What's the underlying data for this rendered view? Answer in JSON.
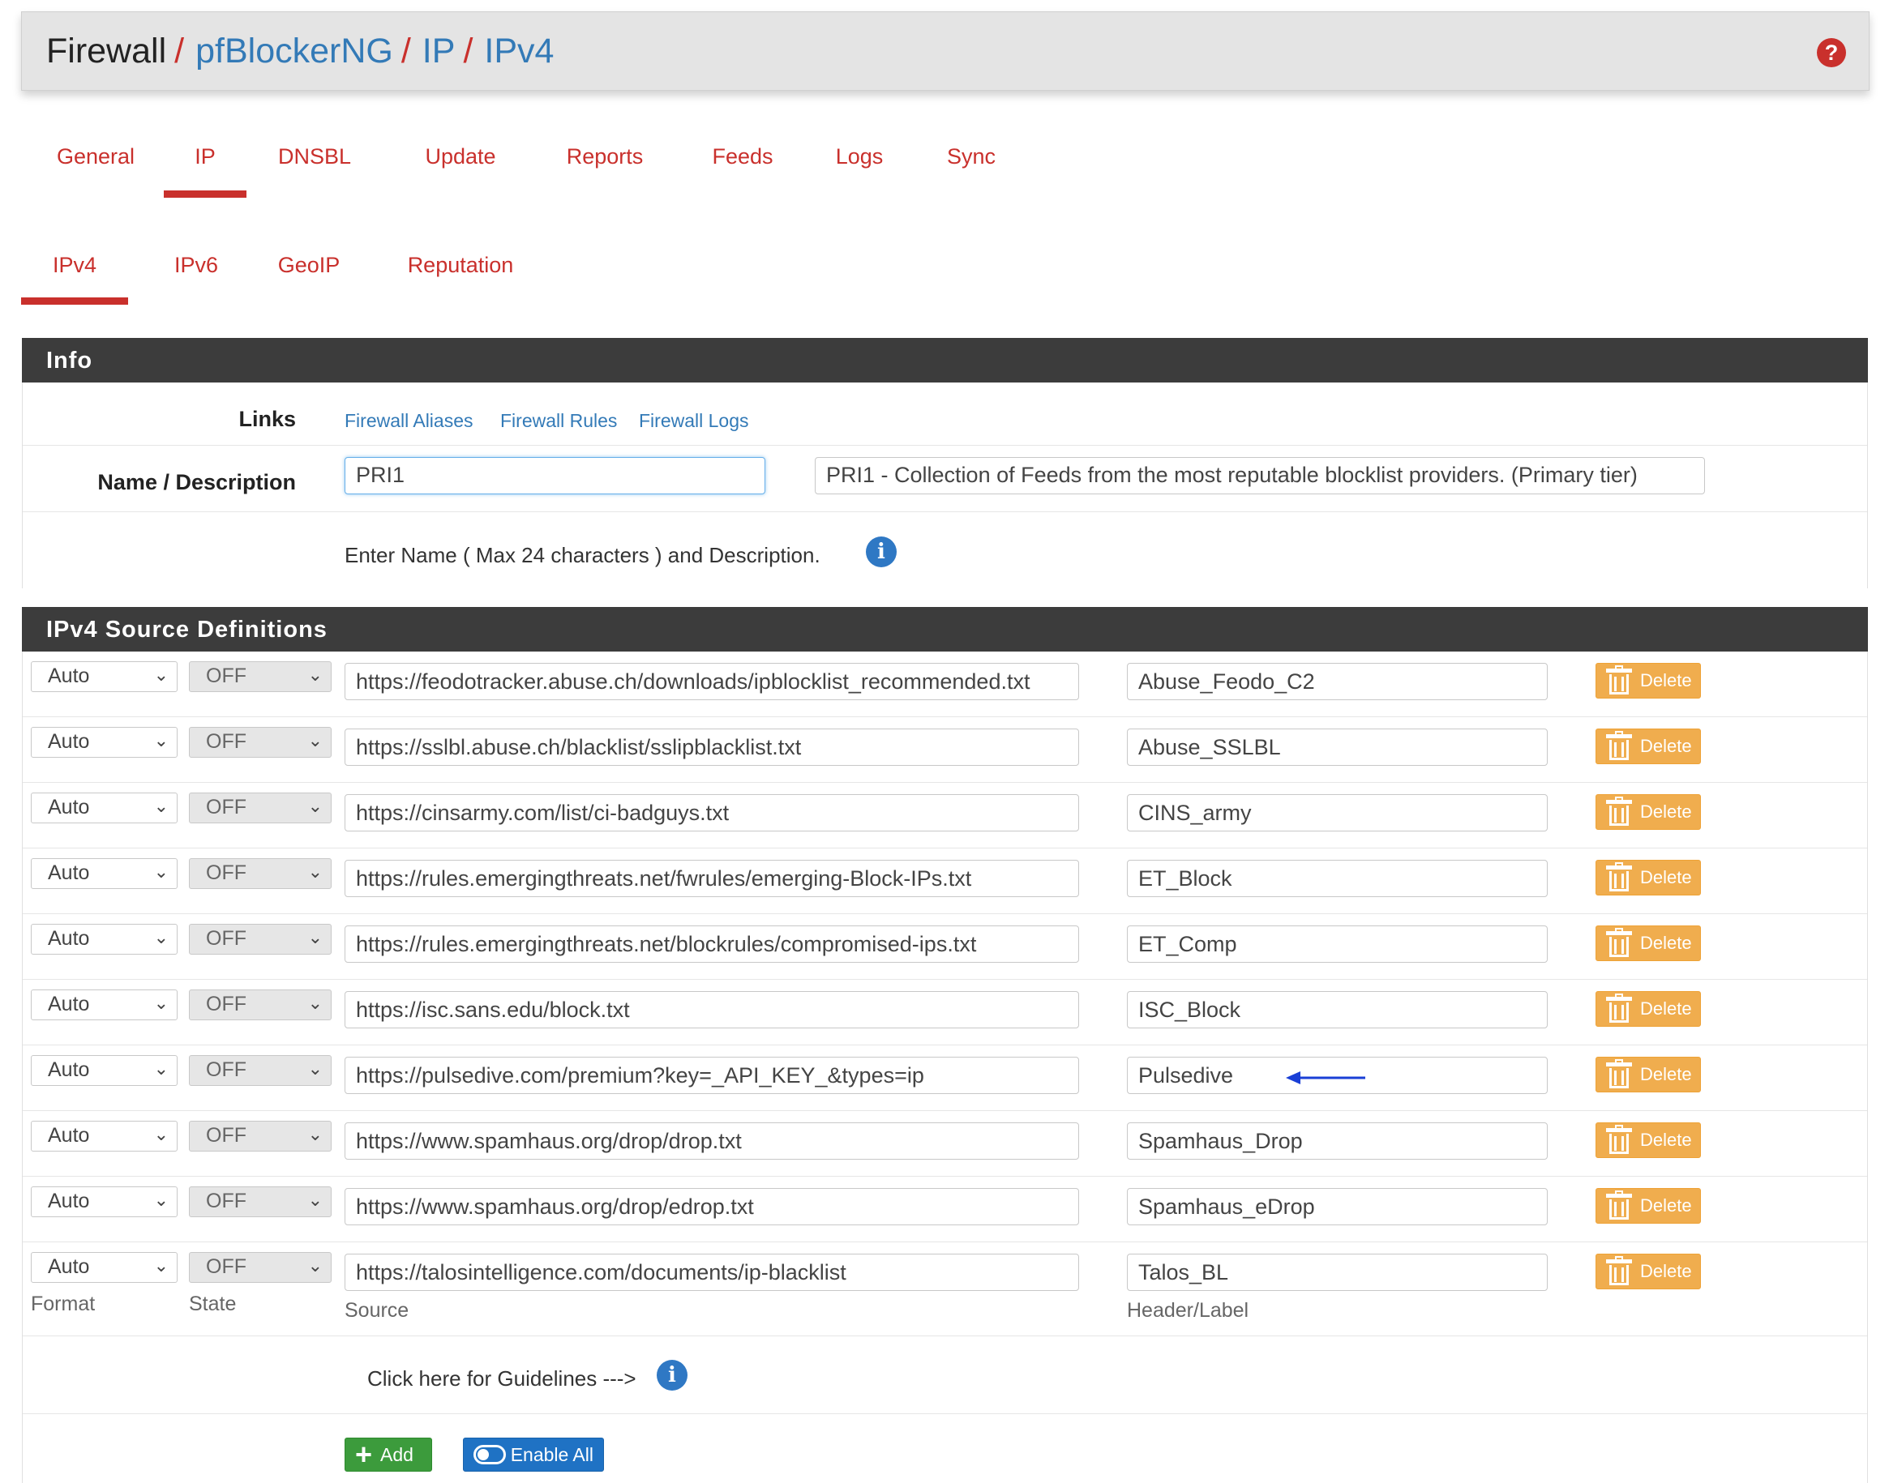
{
  "breadcrumb": {
    "items": [
      "Firewall",
      "pfBlockerNG",
      "IP",
      "IPv4"
    ],
    "separator": "/"
  },
  "help_icon": "question-circle-icon",
  "tabs": [
    "General",
    "IP",
    "DNSBL",
    "Update",
    "Reports",
    "Feeds",
    "Logs",
    "Sync"
  ],
  "active_tab": "IP",
  "subtabs": [
    "IPv4",
    "IPv6",
    "GeoIP",
    "Reputation"
  ],
  "active_subtab": "IPv4",
  "info": {
    "heading": "Info",
    "links_label": "Links",
    "links": [
      "Firewall Aliases",
      "Firewall Rules",
      "Firewall Logs"
    ],
    "name_label": "Name / Description",
    "name_value": "PRI1",
    "description_value": "PRI1 - Collection of Feeds from the most reputable blocklist providers. (Primary tier)",
    "help_text": "Enter Name ( Max 24 characters ) and Description."
  },
  "sources": {
    "heading": "IPv4 Source Definitions",
    "delete_label": "Delete",
    "rows": [
      {
        "format": "Auto",
        "state": "OFF",
        "source": "https://feodotracker.abuse.ch/downloads/ipblocklist_recommended.txt",
        "label": "Abuse_Feodo_C2"
      },
      {
        "format": "Auto",
        "state": "OFF",
        "source": "https://sslbl.abuse.ch/blacklist/sslipblacklist.txt",
        "label": "Abuse_SSLBL"
      },
      {
        "format": "Auto",
        "state": "OFF",
        "source": "https://cinsarmy.com/list/ci-badguys.txt",
        "label": "CINS_army"
      },
      {
        "format": "Auto",
        "state": "OFF",
        "source": "https://rules.emergingthreats.net/fwrules/emerging-Block-IPs.txt",
        "label": "ET_Block"
      },
      {
        "format": "Auto",
        "state": "OFF",
        "source": "https://rules.emergingthreats.net/blockrules/compromised-ips.txt",
        "label": "ET_Comp"
      },
      {
        "format": "Auto",
        "state": "OFF",
        "source": "https://isc.sans.edu/block.txt",
        "label": "ISC_Block"
      },
      {
        "format": "Auto",
        "state": "OFF",
        "source": "https://pulsedive.com/premium?key=_API_KEY_&types=ip",
        "label": "Pulsedive"
      },
      {
        "format": "Auto",
        "state": "OFF",
        "source": "https://www.spamhaus.org/drop/drop.txt",
        "label": "Spamhaus_Drop"
      },
      {
        "format": "Auto",
        "state": "OFF",
        "source": "https://www.spamhaus.org/drop/edrop.txt",
        "label": "Spamhaus_eDrop"
      },
      {
        "format": "Auto",
        "state": "OFF",
        "source": "https://talosintelligence.com/documents/ip-blacklist",
        "label": "Talos_BL"
      }
    ],
    "col_labels": {
      "format": "Format",
      "state": "State",
      "source": "Source",
      "label": "Header/Label"
    },
    "guidelines_text": "Click here for Guidelines --->",
    "add_label": "Add",
    "enable_all_label": "Enable All"
  },
  "colors": {
    "accent_red": "#c9302c",
    "link_blue": "#337ab7",
    "panel_dark": "#3c3c3c",
    "delete_orange": "#f0ad4e",
    "add_green": "#3c9b3c",
    "enable_blue": "#1f72c4",
    "annotation_arrow": "#1a3fd6"
  }
}
